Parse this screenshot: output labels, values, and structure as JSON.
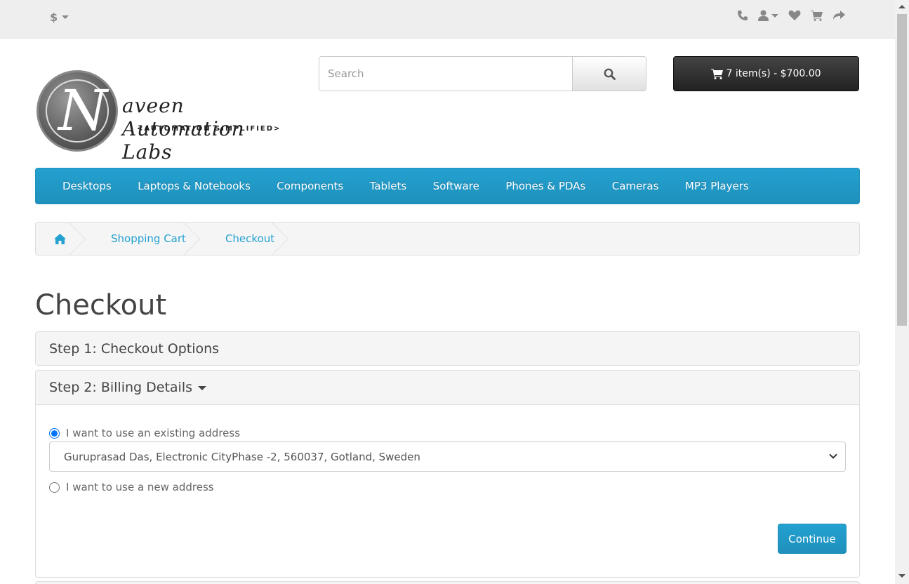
{
  "topbar": {
    "currency_symbol": "$",
    "icons": [
      "phone-icon",
      "user-icon",
      "heart-icon",
      "shopping-cart-icon",
      "share-icon"
    ]
  },
  "logo": {
    "letter": "N",
    "script": "aveen Automation Labs",
    "tagline": "<AUTOMATION SIMPLIFIED>"
  },
  "search": {
    "placeholder": "Search"
  },
  "cart": {
    "label": "7 item(s) - $700.00"
  },
  "nav": {
    "items": [
      "Desktops",
      "Laptops & Notebooks",
      "Components",
      "Tablets",
      "Software",
      "Phones & PDAs",
      "Cameras",
      "MP3 Players"
    ]
  },
  "breadcrumb": {
    "items": [
      "Shopping Cart",
      "Checkout"
    ]
  },
  "page": {
    "title": "Checkout"
  },
  "steps": {
    "step1": "Step 1: Checkout Options",
    "step2": "Step 2: Billing Details"
  },
  "billing": {
    "existing_label": "I want to use an existing address",
    "existing_selected": true,
    "selected_address": "Guruprasad Das, Electronic CityPhase -2, 560037, Gotland, Sweden",
    "new_label": "I want to use a new address",
    "continue_label": "Continue"
  },
  "colors": {
    "accent": "#23a1d1",
    "cart_bg": "#333333",
    "radio_checked": "#0075ff"
  }
}
